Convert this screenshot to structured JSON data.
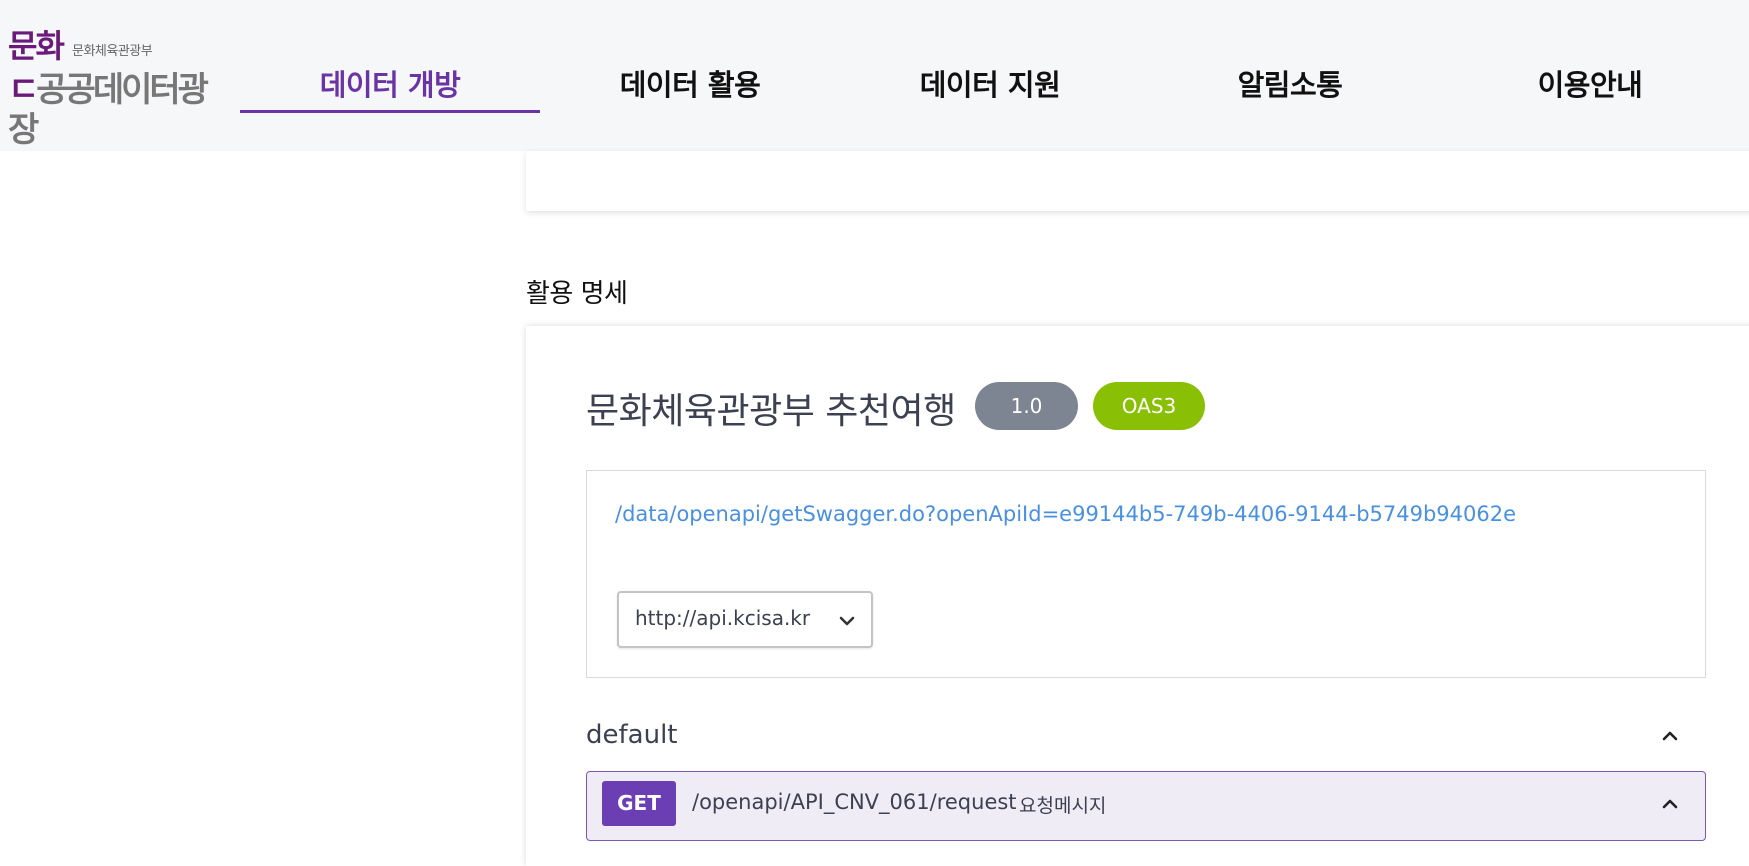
{
  "logo": {
    "line1": "문화",
    "line1_small": "문화체육관광부",
    "line2_first": "ㄷ",
    "line2": "공공데이터광장"
  },
  "nav": {
    "items": [
      {
        "label": "데이터 개방",
        "active": true
      },
      {
        "label": "데이터 활용",
        "active": false
      },
      {
        "label": "데이터 지원",
        "active": false
      },
      {
        "label": "알림소통",
        "active": false
      },
      {
        "label": "이용안내",
        "active": false
      }
    ]
  },
  "section": {
    "title": "활용 명세"
  },
  "api": {
    "title": "문화체육관광부 추천여행",
    "version": "1.0",
    "oas": "OAS3",
    "spec_url": "/data/openapi/getSwagger.do?openApiId=e99144b5-749b-4406-9144-b5749b94062e",
    "server": "http://api.kcisa.kr"
  },
  "tag": {
    "name": "default"
  },
  "operation": {
    "method": "GET",
    "path": "/openapi/API_CNV_061/request",
    "description": "요청메시지"
  },
  "colors": {
    "accent": "#6b34a4",
    "version_badge": "#7d8492",
    "oas_badge": "#89bf04",
    "link": "#4990e2",
    "get_method": "#6b3fb3"
  },
  "icons": {
    "server_dropdown": "chevron-down-icon",
    "tag_toggle": "chevron-up-icon",
    "operation_toggle": "chevron-up-icon"
  }
}
